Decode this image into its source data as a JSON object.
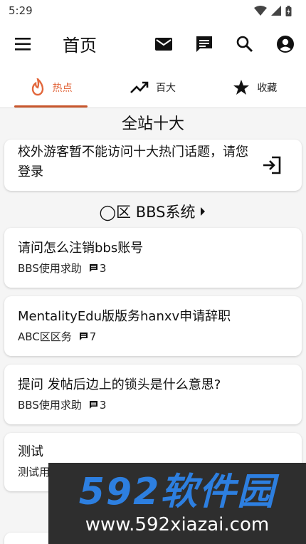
{
  "status_bar": {
    "time": "5:29"
  },
  "app_bar": {
    "title": "首页"
  },
  "tabs": [
    {
      "label": "热点",
      "icon": "fire-icon",
      "active": true
    },
    {
      "label": "百大",
      "icon": "trending-up-icon",
      "active": false
    },
    {
      "label": "收藏",
      "icon": "star-icon",
      "active": false
    }
  ],
  "top10": {
    "title": "全站十大",
    "login_prompt": "校外游客暂不能访问十大热门话题，请您登录"
  },
  "board": {
    "title": "◯区 BBS系统",
    "posts": [
      {
        "title": "请问怎么注销bbs账号",
        "board": "BBS使用求助",
        "replies": "3"
      },
      {
        "title": "MentalityEdu版版务hanxv申请辞职",
        "board": "ABC区区务",
        "replies": "7"
      },
      {
        "title": "提问 发帖后边上的锁头是什么意思?",
        "board": "BBS使用求助",
        "replies": "3"
      },
      {
        "title": "测试",
        "board": "测试用",
        "replies": ""
      }
    ]
  },
  "watermark": {
    "brand": "592软件园",
    "url": "www.592xiazai.com"
  },
  "colors": {
    "accent": "#e2673c",
    "watermark_blue": "#2d7fe0"
  }
}
